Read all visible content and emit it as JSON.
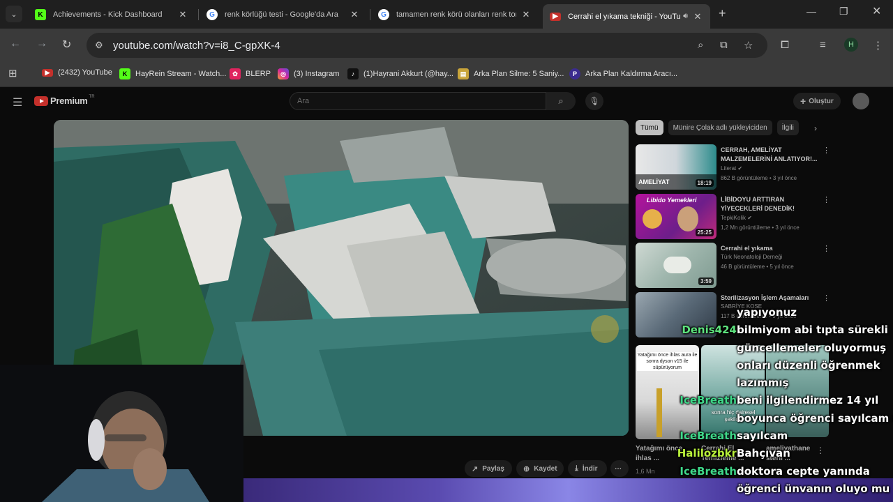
{
  "browser": {
    "tabs": [
      {
        "title": "Achievements - Kick Dashboard",
        "favicon": "kick-icon",
        "active": false
      },
      {
        "title": "renk körlüğü testi - Google'da Ara",
        "favicon": "google-icon",
        "active": false
      },
      {
        "title": "tamamen renk körü olanları renk tonları",
        "favicon": "google-icon",
        "active": false
      },
      {
        "title": "Cerrahi el yıkama tekniği - YouTube",
        "favicon": "youtube-icon",
        "active": true
      }
    ],
    "url": "youtube.com/watch?v=i8_C-gpXK-4",
    "profile_initial": "H",
    "bookmarks": [
      {
        "label": "(2432) YouTube",
        "icon": "youtube-icon",
        "color": "#c4302b"
      },
      {
        "label": "HayRein Stream - Watch...",
        "icon": "kick-icon",
        "color": "#53fc18"
      },
      {
        "label": "BLERP",
        "icon": "blerp-icon",
        "color": "#e0245e"
      },
      {
        "label": "(3) Instagram",
        "icon": "instagram-icon",
        "color": "#d6249f"
      },
      {
        "label": "(1)Hayrani Akkurt (@hay...",
        "icon": "tiktok-icon",
        "color": "#111111"
      },
      {
        "label": "Arka Plan Silme: 5 Saniy...",
        "icon": "removebg-icon",
        "color": "#c8a43a"
      },
      {
        "label": "Arka Plan Kaldırma Aracı...",
        "icon": "pixelcut-icon",
        "color": "#3b2b8f"
      }
    ]
  },
  "youtube": {
    "logo_text": "Premium",
    "region": "TR",
    "search_placeholder": "Ara",
    "create_label": "Oluştur",
    "actions": {
      "share": "Paylaş",
      "save": "Kaydet",
      "download": "İndir"
    },
    "chips": [
      "Tümü",
      "Münire Çolak adlı yükleyiciden",
      "İlgili"
    ],
    "recommendations": [
      {
        "title": "CERRAH, AMELİYAT MALZEMELERİNİ ANLATIYOR!...",
        "channel": "Literat",
        "verified": true,
        "meta": "862 B görüntüleme • 3 yıl önce",
        "duration": "18:19",
        "thumb_text": "AMELİYAT"
      },
      {
        "title": "LİBİDOYU ARTTIRAN YİYECEKLERİ DENEDİK!",
        "channel": "TepkiKolik",
        "verified": true,
        "meta": "1,2 Mn görüntüleme • 3 yıl önce",
        "duration": "25:25",
        "thumb_text": "Libido Yemekleri"
      },
      {
        "title": "Cerrahi el yıkama",
        "channel": "Türk Neonatoloji Derneği",
        "verified": false,
        "meta": "46 B görüntüleme • 5 yıl önce",
        "duration": "3:59",
        "thumb_text": ""
      },
      {
        "title": "Sterilizasyon İşlem Aşamaları",
        "channel": "SABRİYE KOSE",
        "verified": false,
        "meta": "117 B görüntüleme • 9 yıl önce",
        "duration": "",
        "thumb_text": ""
      }
    ],
    "shorts": [
      {
        "title": "Yatağımı önce ihlas ...",
        "meta": "1,6 Mn",
        "caption": "Yatağımı önce ihlas aura ile sonra dyson v15 ile süpürüyorum"
      },
      {
        "title": "Cerrahi El Temizleme ...",
        "meta": "",
        "caption": "sonra hiç dairesel şekilde"
      },
      {
        "title": "ameliyathane steril ...",
        "meta": "",
        "caption": ""
      }
    ]
  },
  "chat": [
    {
      "user": "",
      "color": "#5ee37e",
      "message": "yapıyonuz"
    },
    {
      "user": "Denis424",
      "color": "#5ee37e",
      "message": "bilmiyom abi tıpta sürekli"
    },
    {
      "user": "",
      "color": "#5ee37e",
      "message": "güncellemeler oluyormuş"
    },
    {
      "user": "",
      "color": "#5ee37e",
      "message": "onları düzenli öğrenmek"
    },
    {
      "user": "",
      "color": "#5ee37e",
      "message": "lazımmış"
    },
    {
      "user": "IceBreath",
      "color": "#3fd98a",
      "message": "beni ilgilendirmez 14 yıl"
    },
    {
      "user": "",
      "color": "#3fd98a",
      "message": "boyunca öğrenci sayılcam mı"
    },
    {
      "user": "IceBreath",
      "color": "#3fd98a",
      "message": "sayılcam"
    },
    {
      "user": "Halilozbkr",
      "color": "#b8f03a",
      "message": "Bahçıvan"
    },
    {
      "user": "IceBreath",
      "color": "#3fd98a",
      "message": "doktora cepte yanında"
    },
    {
      "user": "",
      "color": "#3fd98a",
      "message": "öğrenci ünvanın oluyo mu"
    }
  ]
}
